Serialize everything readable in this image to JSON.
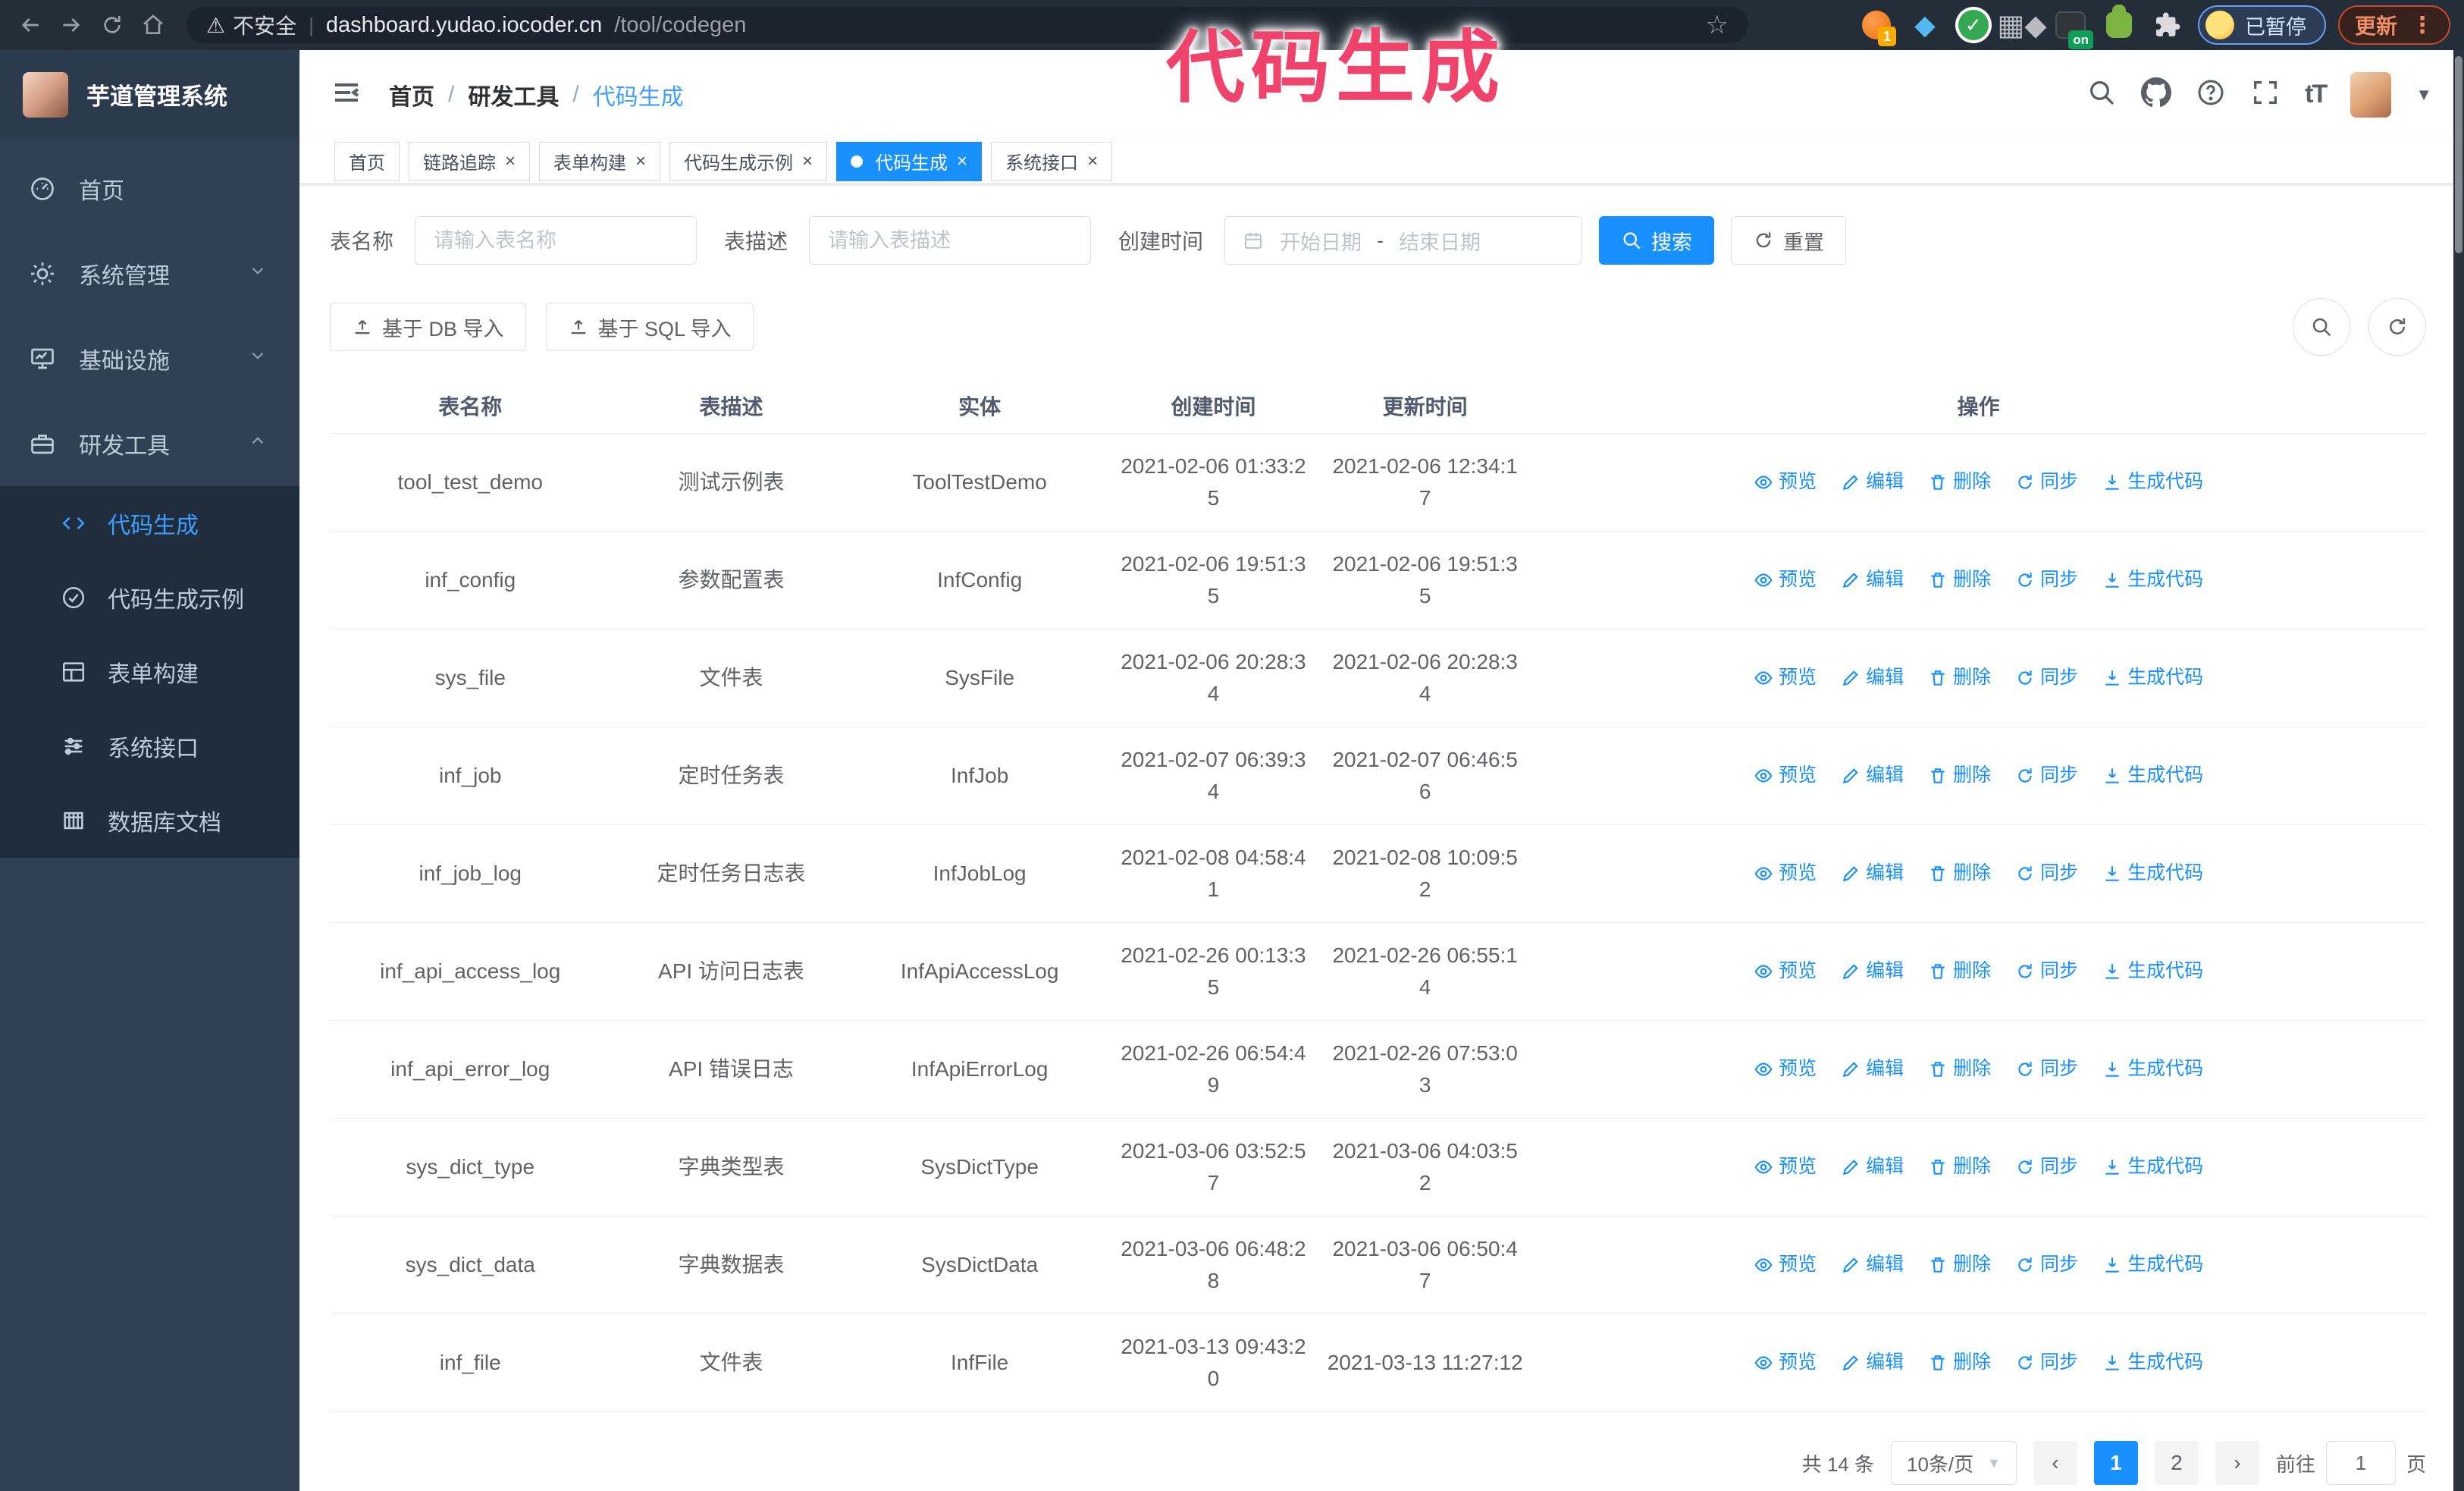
{
  "browser": {
    "security_label": "不安全",
    "url_domain": "dashboard.yudao.iocoder.cn",
    "url_path": "/tool/codegen",
    "profile_status": "已暂停",
    "update_label": "更新",
    "ext_badge_count": "1",
    "ext_badge_on": "on"
  },
  "icons": {
    "warning": "⚠",
    "pipe": "|",
    "bookmark_star": "☆",
    "gem": "◆",
    "grid": "▦",
    "mini_gem": "◆",
    "check": "✓",
    "dots_vertical": "⋮",
    "close": "×",
    "caret_down": "▼",
    "font_size": "tT",
    "prev": "‹",
    "next": "›"
  },
  "app": {
    "logo_title": "芋道管理系统",
    "breadcrumb": {
      "items": [
        "首页",
        "研发工具",
        "代码生成"
      ],
      "separator": "/"
    },
    "sidebar": {
      "items": [
        {
          "label": "首页"
        },
        {
          "label": "系统管理"
        },
        {
          "label": "基础设施"
        },
        {
          "label": "研发工具"
        }
      ],
      "submenu": [
        {
          "label": "代码生成",
          "active": true
        },
        {
          "label": "代码生成示例"
        },
        {
          "label": "表单构建"
        },
        {
          "label": "系统接口"
        },
        {
          "label": "数据库文档"
        }
      ]
    },
    "tabs": [
      {
        "label": "首页",
        "active": false,
        "closable": false
      },
      {
        "label": "链路追踪",
        "active": false,
        "closable": true
      },
      {
        "label": "表单构建",
        "active": false,
        "closable": true
      },
      {
        "label": "代码生成示例",
        "active": false,
        "closable": true
      },
      {
        "label": "代码生成",
        "active": true,
        "closable": true
      },
      {
        "label": "系统接口",
        "active": false,
        "closable": true
      }
    ]
  },
  "search": {
    "name_label": "表名称",
    "name_placeholder": "请输入表名称",
    "desc_label": "表描述",
    "desc_placeholder": "请输入表描述",
    "time_label": "创建时间",
    "start_placeholder": "开始日期",
    "range_separator": "-",
    "end_placeholder": "结束日期",
    "search_label": "搜索",
    "reset_label": "重置"
  },
  "toolbar": {
    "import_db_label": "基于 DB 导入",
    "import_sql_label": "基于 SQL 导入"
  },
  "table": {
    "columns": [
      "表名称",
      "表描述",
      "实体",
      "创建时间",
      "更新时间",
      "操作"
    ],
    "action_labels": [
      "预览",
      "编辑",
      "删除",
      "同步",
      "生成代码"
    ],
    "rows": [
      {
        "name": "tool_test_demo",
        "desc": "测试示例表",
        "entity": "ToolTestDemo",
        "created": "2021-02-06 01:33:25",
        "updated": "2021-02-06 12:34:17"
      },
      {
        "name": "inf_config",
        "desc": "参数配置表",
        "entity": "InfConfig",
        "created": "2021-02-06 19:51:35",
        "updated": "2021-02-06 19:51:35"
      },
      {
        "name": "sys_file",
        "desc": "文件表",
        "entity": "SysFile",
        "created": "2021-02-06 20:28:34",
        "updated": "2021-02-06 20:28:34"
      },
      {
        "name": "inf_job",
        "desc": "定时任务表",
        "entity": "InfJob",
        "created": "2021-02-07 06:39:34",
        "updated": "2021-02-07 06:46:56"
      },
      {
        "name": "inf_job_log",
        "desc": "定时任务日志表",
        "entity": "InfJobLog",
        "created": "2021-02-08 04:58:41",
        "updated": "2021-02-08 10:09:52"
      },
      {
        "name": "inf_api_access_log",
        "desc": "API 访问日志表",
        "entity": "InfApiAccessLog",
        "created": "2021-02-26 00:13:35",
        "updated": "2021-02-26 06:55:14"
      },
      {
        "name": "inf_api_error_log",
        "desc": "API 错误日志",
        "entity": "InfApiErrorLog",
        "created": "2021-02-26 06:54:49",
        "updated": "2021-02-26 07:53:03"
      },
      {
        "name": "sys_dict_type",
        "desc": "字典类型表",
        "entity": "SysDictType",
        "created": "2021-03-06 03:52:57",
        "updated": "2021-03-06 04:03:52"
      },
      {
        "name": "sys_dict_data",
        "desc": "字典数据表",
        "entity": "SysDictData",
        "created": "2021-03-06 06:48:28",
        "updated": "2021-03-06 06:50:47"
      },
      {
        "name": "inf_file",
        "desc": "文件表",
        "entity": "InfFile",
        "created": "2021-03-13 09:43:20",
        "updated": "2021-03-13 11:27:12"
      }
    ]
  },
  "pagination": {
    "total_label": "共 14 条",
    "page_size_label": "10条/页",
    "pages": [
      "1",
      "2"
    ],
    "active_page": "1",
    "goto_label": "前往",
    "goto_value": "1",
    "goto_unit": "页"
  },
  "annotation": {
    "text": "代码生成"
  },
  "colors": {
    "accent": "#1890ff",
    "sidebar": "#304156",
    "submenu": "#1f2d3d",
    "annotation": "#f0436b"
  }
}
